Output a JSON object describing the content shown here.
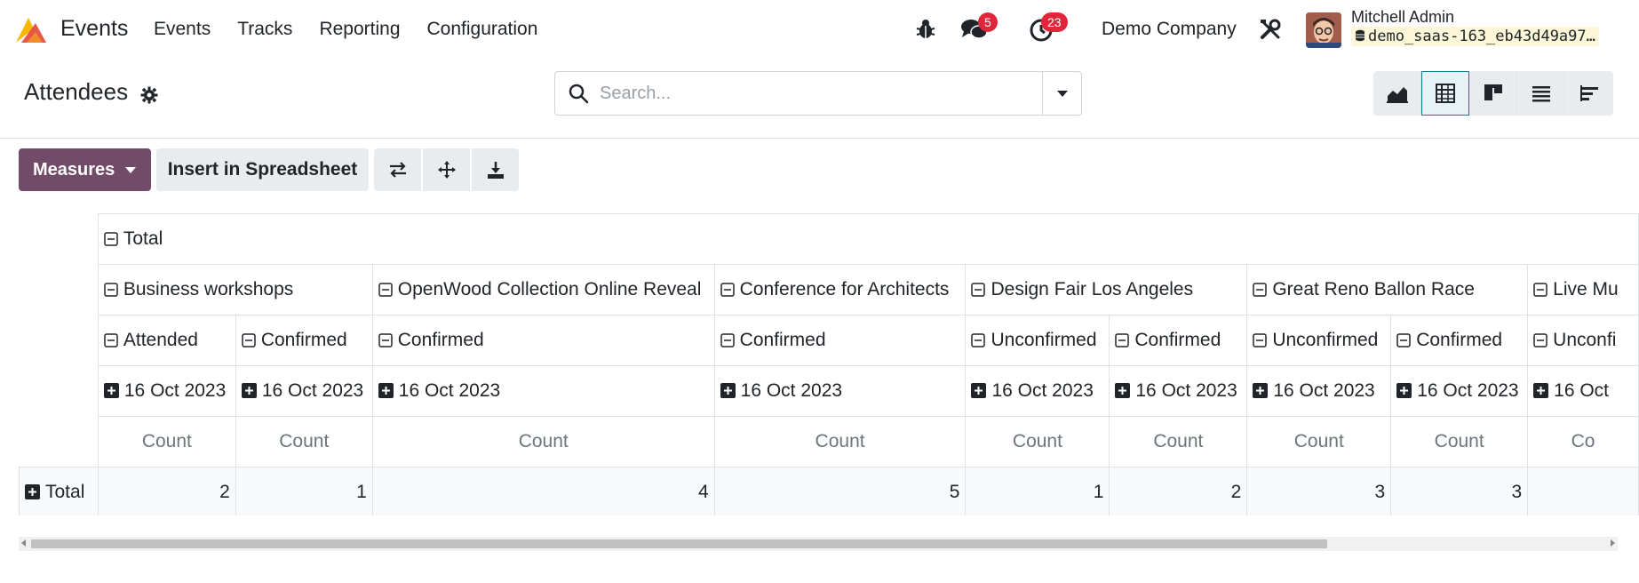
{
  "navbar": {
    "app_name": "Events",
    "menu": [
      "Events",
      "Tracks",
      "Reporting",
      "Configuration"
    ],
    "messages_count": "5",
    "activities_count": "23",
    "company": "Demo Company",
    "user_name": "Mitchell Admin",
    "database": "demo_saas-163_eb43d49a97…"
  },
  "control_panel": {
    "breadcrumb": "Attendees",
    "search_placeholder": "Search..."
  },
  "buttons": {
    "measures": "Measures",
    "insert": "Insert in Spreadsheet"
  },
  "pivot": {
    "total_header": "Total",
    "events": [
      "Business workshops",
      "OpenWood Collection Online Reveal",
      "Conference for Architects",
      "Design Fair Los Angeles",
      "Great Reno Ballon Race",
      "Live Mu"
    ],
    "statuses": [
      "Attended",
      "Confirmed",
      "Confirmed",
      "Confirmed",
      "Unconfirmed",
      "Confirmed",
      "Unconfirmed",
      "Confirmed",
      "Unconfi"
    ],
    "dates": [
      "16 Oct 2023",
      "16 Oct 2023",
      "16 Oct 2023",
      "16 Oct 2023",
      "16 Oct 2023",
      "16 Oct 2023",
      "16 Oct 2023",
      "16 Oct 2023",
      "16 Oct"
    ],
    "measures": [
      "Count",
      "Count",
      "Count",
      "Count",
      "Count",
      "Count",
      "Count",
      "Count",
      "Co"
    ],
    "row_label": "Total",
    "values": [
      "2",
      "1",
      "4",
      "5",
      "1",
      "2",
      "3",
      "3",
      ""
    ]
  },
  "colors": {
    "primary": "#714b67",
    "badge": "#e0263a",
    "active_view": "#017e84"
  }
}
